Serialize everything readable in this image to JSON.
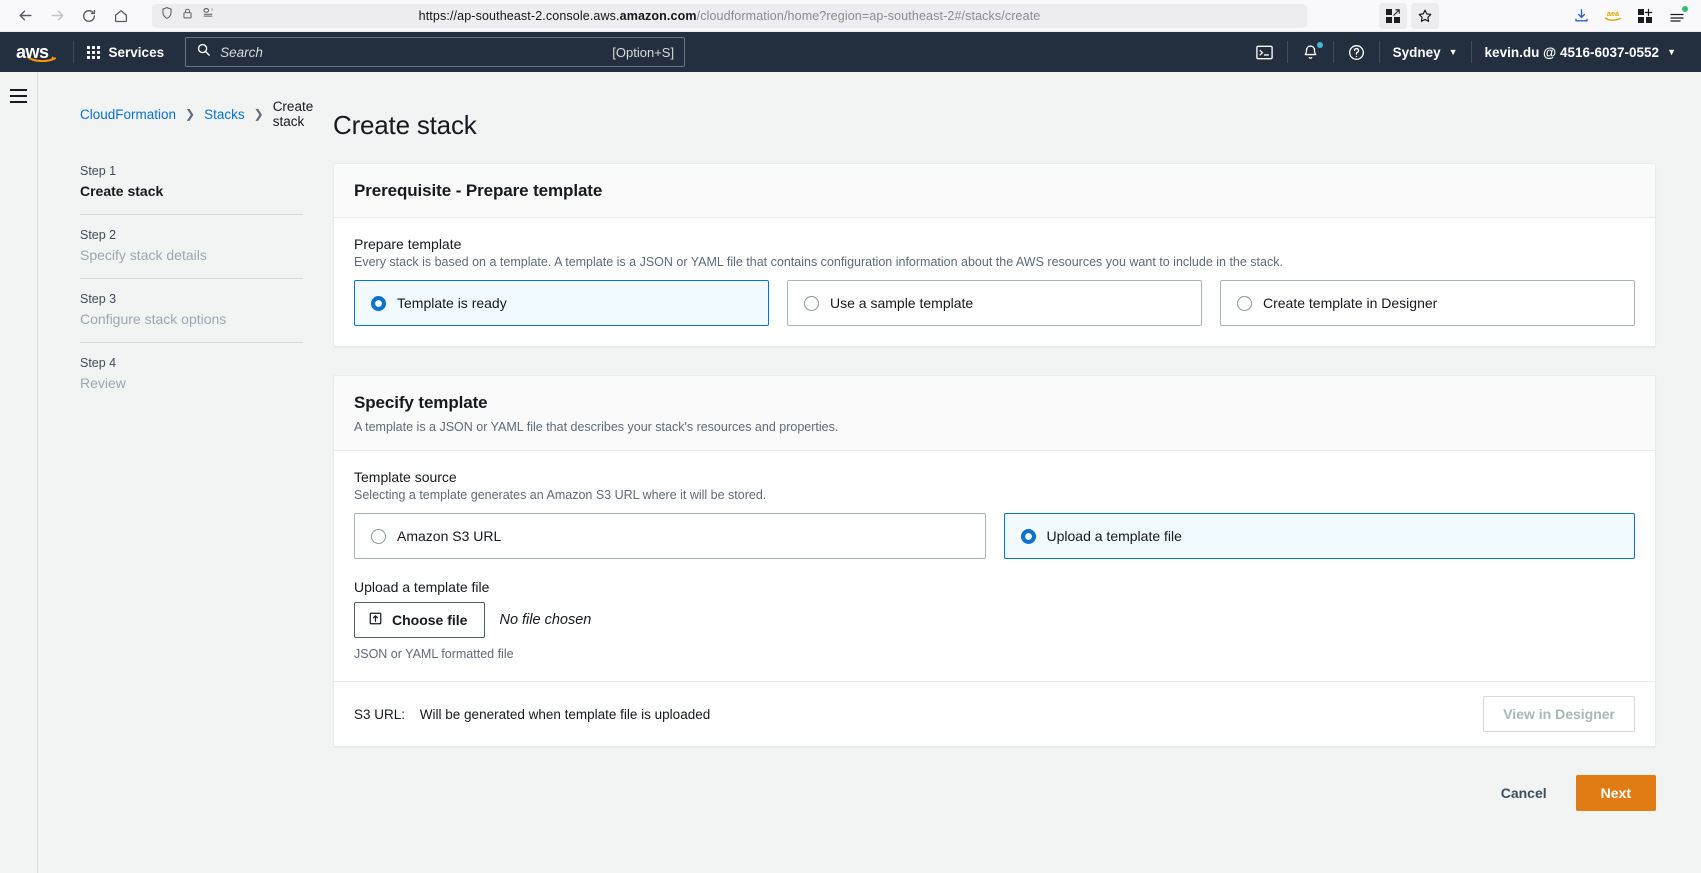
{
  "browser": {
    "nav": {
      "back": "back-arrow",
      "forward": "forward-arrow",
      "reload": "reload",
      "home": "home"
    },
    "url": {
      "scheme_host_prefix": "https://ap-southeast-2.console.aws.",
      "host_bold": "amazon.com",
      "path": "/cloudformation/home?region=ap-southeast-2#/stacks/create",
      "full": "https://ap-southeast-2.console.aws.amazon.com/cloudformation/home?region=ap-southeast-2#/stacks/create"
    },
    "icons": {
      "shield": "shield-icon",
      "lock": "lock-icon",
      "reader": "reader-view-icon",
      "extensions": "extensions-icon",
      "bookmark": "bookmark-star-icon",
      "downloads": "downloads-icon",
      "account": "amazon-account-icon",
      "addons": "add-extension-icon",
      "menu": "app-menu-icon"
    }
  },
  "aws_header": {
    "logo": "aws",
    "services_label": "Services",
    "search_placeholder": "Search",
    "search_shortcut": "[Option+S]",
    "cloudshell": "cloudshell-icon",
    "notifications": "bell-icon",
    "help": "help-icon",
    "region": "Sydney",
    "account": "kevin.du @ 4516-6037-0552"
  },
  "breadcrumb": [
    {
      "label": "CloudFormation",
      "link": true
    },
    {
      "label": "Stacks",
      "link": true
    },
    {
      "label": "Create stack",
      "link": false
    }
  ],
  "steps": [
    {
      "num": "Step 1",
      "label": "Create stack",
      "active": true
    },
    {
      "num": "Step 2",
      "label": "Specify stack details",
      "active": false
    },
    {
      "num": "Step 3",
      "label": "Configure stack options",
      "active": false
    },
    {
      "num": "Step 4",
      "label": "Review",
      "active": false
    }
  ],
  "page": {
    "title": "Create stack"
  },
  "prerequisite": {
    "card_title": "Prerequisite - Prepare template",
    "field_label": "Prepare template",
    "field_desc": "Every stack is based on a template. A template is a JSON or YAML file that contains configuration information about the AWS resources you want to include in the stack.",
    "options": [
      {
        "label": "Template is ready",
        "selected": true
      },
      {
        "label": "Use a sample template",
        "selected": false
      },
      {
        "label": "Create template in Designer",
        "selected": false
      }
    ]
  },
  "specify_template": {
    "card_title": "Specify template",
    "card_sub": "A template is a JSON or YAML file that describes your stack's resources and properties.",
    "source_label": "Template source",
    "source_desc": "Selecting a template generates an Amazon S3 URL where it will be stored.",
    "source_options": [
      {
        "label": "Amazon S3 URL",
        "selected": false
      },
      {
        "label": "Upload a template file",
        "selected": true
      }
    ],
    "upload_label": "Upload a template file",
    "choose_file_button": "Choose file",
    "file_status": "No file chosen",
    "upload_hint": "JSON or YAML formatted file",
    "s3_url_key": "S3 URL:",
    "s3_url_value": "Will be generated when template file is uploaded",
    "view_designer_button": "View in Designer"
  },
  "actions": {
    "cancel": "Cancel",
    "next": "Next"
  },
  "colors": {
    "aws_header_bg": "#232f3e",
    "link_blue": "#0972d3",
    "primary_orange": "#e07c13",
    "selected_tile_bg": "#f1faff"
  }
}
